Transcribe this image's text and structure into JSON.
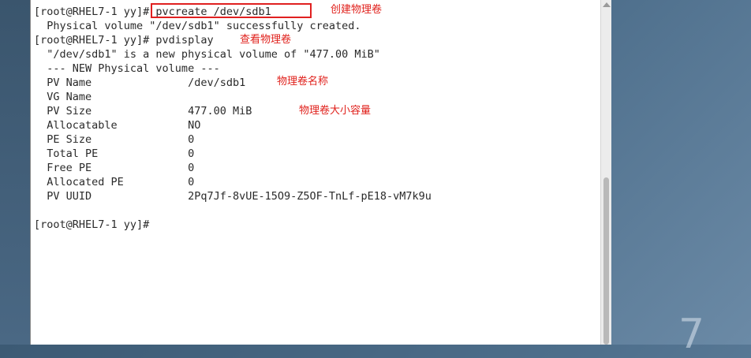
{
  "terminal": {
    "lines": [
      "[root@RHEL7-1 yy]# pvcreate /dev/sdb1",
      "  Physical volume \"/dev/sdb1\" successfully created.",
      "[root@RHEL7-1 yy]# pvdisplay",
      "  \"/dev/sdb1\" is a new physical volume of \"477.00 MiB\"",
      "  --- NEW Physical volume ---",
      "  PV Name               /dev/sdb1",
      "  VG Name",
      "  PV Size               477.00 MiB",
      "  Allocatable           NO",
      "  PE Size               0",
      "  Total PE              0",
      "  Free PE               0",
      "  Allocated PE          0",
      "  PV UUID               2Pq7Jf-8vUE-15O9-Z5OF-TnLf-pE18-vM7k9u",
      "",
      "[root@RHEL7-1 yy]# "
    ]
  },
  "annotations": {
    "create_pv": "创建物理卷",
    "view_pv": "查看物理卷",
    "pv_name": "物理卷名称",
    "pv_size": "物理卷大小容量"
  },
  "desktop": {
    "version_mark": "7"
  }
}
